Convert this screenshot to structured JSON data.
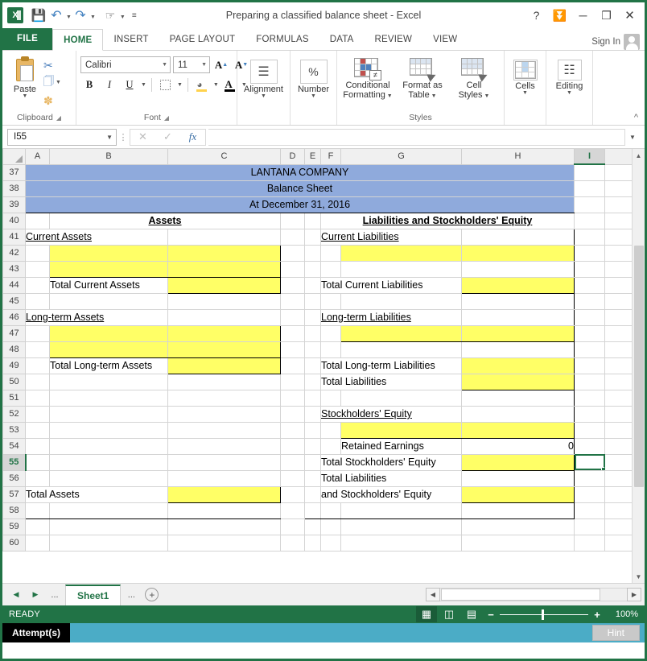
{
  "window": {
    "title": "Preparing a classified balance sheet - Excel",
    "help_icon": "?",
    "ribbon_display_icon": "ribbon-display-options-icon",
    "minimize_icon": "–",
    "restore_icon": "restore-icon",
    "close_icon": "✕"
  },
  "qat": {
    "logo": "X",
    "save_icon": "save-icon",
    "undo_icon": "undo-icon",
    "redo_icon": "redo-icon",
    "touch_icon": "touch-mode-icon",
    "more_icon": "customize-qat-icon"
  },
  "tabs": {
    "file": "FILE",
    "items": [
      "HOME",
      "INSERT",
      "PAGE LAYOUT",
      "FORMULAS",
      "DATA",
      "REVIEW",
      "VIEW"
    ],
    "active": "HOME",
    "signin": "Sign In"
  },
  "ribbon": {
    "clipboard": {
      "label": "Clipboard",
      "paste": "Paste",
      "cut_icon": "scissors-icon",
      "copy_icon": "copy-icon",
      "format_painter_icon": "format-painter-icon",
      "launcher": "⌐"
    },
    "font": {
      "label": "Font",
      "font_name": "Calibri",
      "font_size": "11",
      "grow_font": "A",
      "shrink_font": "A",
      "bold": "B",
      "italic": "I",
      "underline": "U",
      "borders_icon": "borders-icon",
      "fill_color_icon": "fill-color-icon",
      "font_color_icon": "font-color-icon",
      "launcher": "⌐"
    },
    "alignment": {
      "label": "Alignment",
      "icon": "alignment-icon"
    },
    "number": {
      "label": "Number",
      "icon": "percent-icon",
      "glyph": "%"
    },
    "styles": {
      "label": "Styles",
      "conditional_formatting": "Conditional\nFormatting",
      "conditional_formatting_l1": "Conditional",
      "conditional_formatting_l2": "Formatting",
      "format_as_table_l1": "Format as",
      "format_as_table_l2": "Table",
      "cell_styles_l1": "Cell",
      "cell_styles_l2": "Styles"
    },
    "cells": {
      "label": "Cells",
      "icon": "cells-icon"
    },
    "editing": {
      "label": "Editing",
      "icon": "binoculars-icon"
    },
    "collapse_icon": "collapse-ribbon-icon"
  },
  "formula_bar": {
    "name_box": "I55",
    "cancel_icon": "✕",
    "enter_icon": "✓",
    "function_icon": "fx",
    "formula_value": "",
    "expand_icon": "expand-formula-bar-icon"
  },
  "grid": {
    "columns": [
      "A",
      "B",
      "C",
      "D",
      "E",
      "F",
      "G",
      "H",
      "I"
    ],
    "selected_column": "I",
    "selected_row": "55",
    "selected_cell": "I55",
    "row_numbers": [
      37,
      38,
      39,
      40,
      41,
      42,
      43,
      44,
      45,
      46,
      47,
      48,
      49,
      50,
      51,
      52,
      53,
      54,
      55,
      56,
      57,
      58,
      59,
      60
    ],
    "cells": {
      "title_company": "LANTANA COMPANY",
      "title_statement": "Balance Sheet",
      "title_date": "At December 31, 2016",
      "assets_heading": "Assets",
      "liab_equity_heading": "Liabilities and Stockholders' Equity",
      "current_assets": "Current Assets",
      "total_current_assets": "Total Current Assets",
      "longterm_assets": "Long-term Assets",
      "total_longterm_assets": "Total Long-term Assets",
      "total_assets": "Total Assets",
      "current_liabilities": "Current Liabilities",
      "total_current_liabilities": "Total Current Liabilities",
      "longterm_liabilities": "Long-term Liabilities",
      "total_longterm_liabilities": "Total Long-term Liabilities",
      "total_liabilities": "Total Liabilities",
      "stockholders_equity": "Stockholders' Equity",
      "retained_earnings": "Retained Earnings",
      "retained_earnings_value": "0",
      "total_stockholders_equity": "Total Stockholders' Equity",
      "total_liabilities_2": "Total Liabilities",
      "and_stockholders_equity": "and Stockholders' Equity"
    },
    "colors": {
      "header_blue": "#8FAADC",
      "input_yellow": "#FFFF66",
      "selection_green": "#217346"
    }
  },
  "sheet_tabs": {
    "prev_icon": "◀",
    "next_icon": "▶",
    "left_dots": "...",
    "right_dots": "...",
    "active_sheet": "Sheet1",
    "add_sheet_icon": "+"
  },
  "status_bar": {
    "mode": "READY",
    "normal_view_icon": "normal-view-icon",
    "page_layout_icon": "page-layout-view-icon",
    "page_break_icon": "page-break-preview-icon",
    "zoom_out": "−",
    "zoom_in": "+",
    "zoom_level": "100%"
  },
  "attempt_bar": {
    "label": "Attempt(s)",
    "hint_button": "Hint"
  }
}
